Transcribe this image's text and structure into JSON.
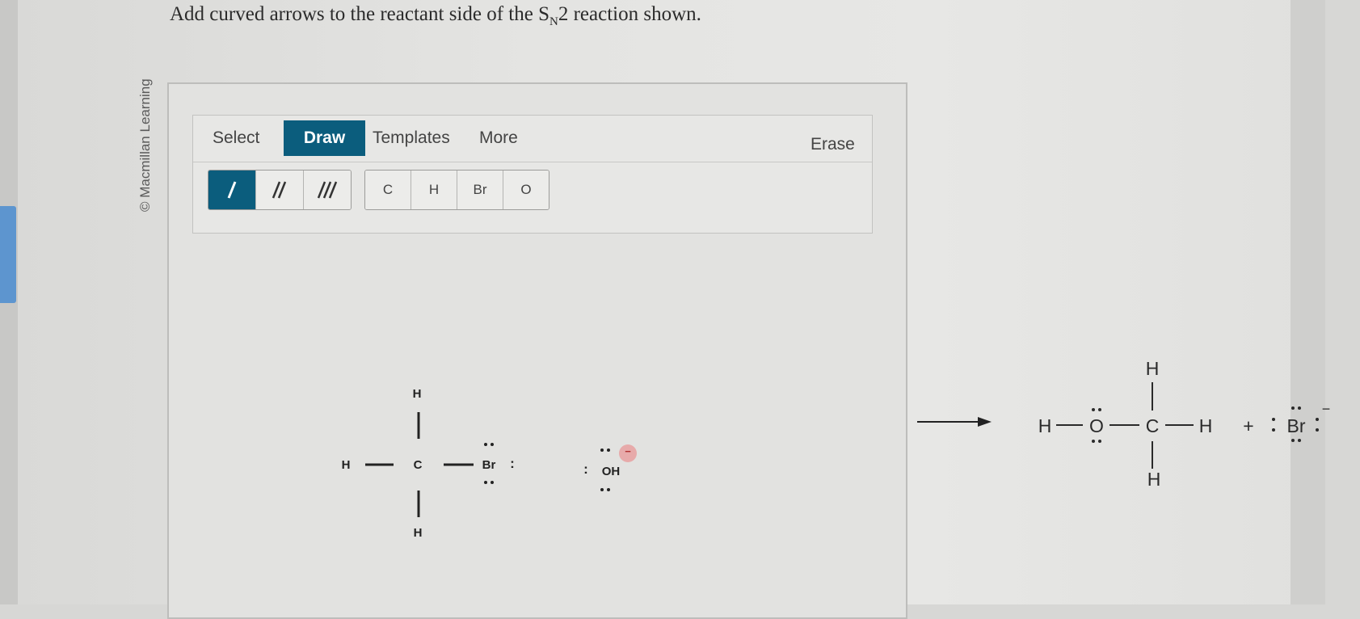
{
  "question": {
    "text_before": "Add curved arrows to the reactant side of the S",
    "subscript": "N",
    "text_after": "2 reaction shown."
  },
  "copyright": "© Macmillan Learning",
  "toolbar": {
    "tabs": [
      {
        "label": "Select",
        "active": false
      },
      {
        "label": "Draw",
        "active": true
      },
      {
        "label": "Templates",
        "active": false
      },
      {
        "label": "More",
        "active": false
      }
    ],
    "erase_label": "Erase",
    "bond_buttons": [
      {
        "name": "single-bond",
        "icon": "single-bond-icon",
        "active": true
      },
      {
        "name": "double-bond",
        "icon": "double-bond-icon",
        "active": false
      },
      {
        "name": "triple-bond",
        "icon": "triple-bond-icon",
        "active": false
      }
    ],
    "atom_buttons": [
      "C",
      "H",
      "Br",
      "O"
    ]
  },
  "reactant": {
    "carbon": "C",
    "h_top": "H",
    "h_left": "H",
    "h_bottom": "H",
    "bromine": "Br",
    "lone_pair_colon": ":",
    "hydroxide": "OH",
    "hydroxide_charge": "−"
  },
  "product": {
    "h_top": "H",
    "h_left": "H",
    "oxygen": "O",
    "carbon": "C",
    "h_right": "H",
    "h_bottom": "H",
    "plus": "+",
    "bromide": "Br",
    "bromide_charge": "−"
  },
  "colors": {
    "accent": "#0b5d7d",
    "charge_badge": "#e8a0a0",
    "tab_indicator": "#5d95cf"
  }
}
